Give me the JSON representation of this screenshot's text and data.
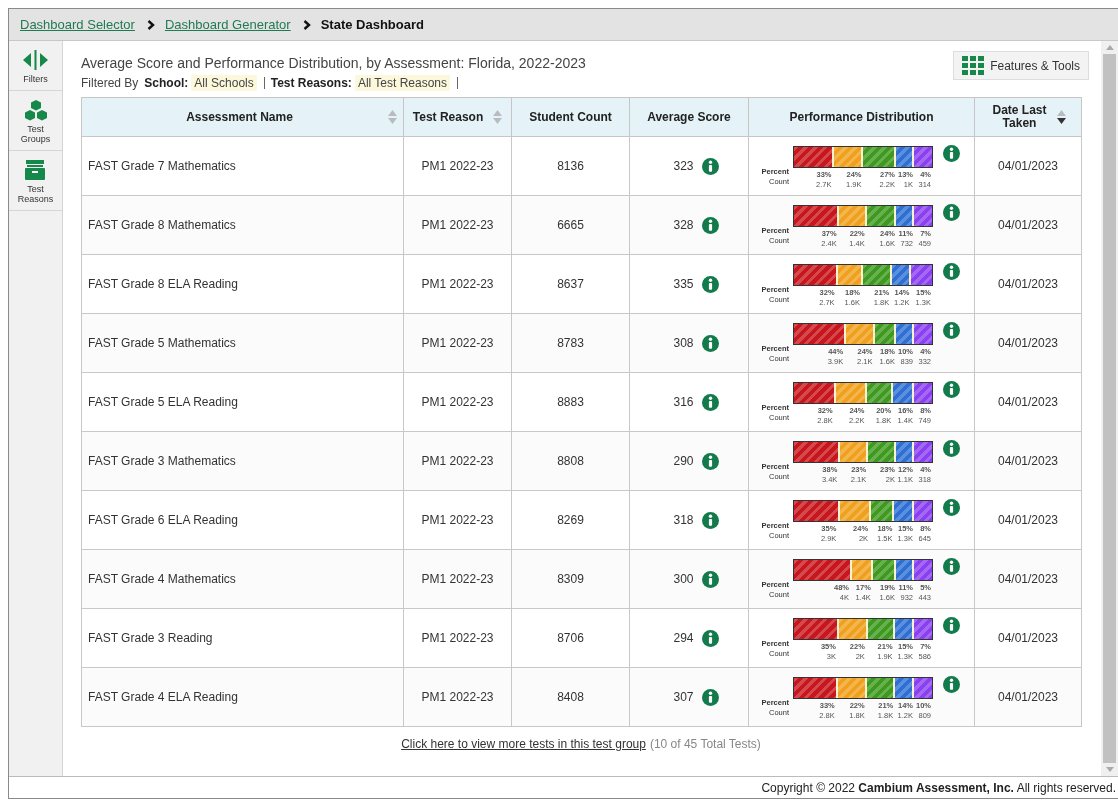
{
  "breadcrumbs": [
    {
      "label": "Dashboard Selector",
      "kind": "link"
    },
    {
      "label": "Dashboard Generator",
      "kind": "link"
    },
    {
      "label": "State Dashboard",
      "kind": "current"
    }
  ],
  "sidebar": {
    "items": [
      {
        "label": "Filters",
        "kind": "filters"
      },
      {
        "label": "Test Groups",
        "kind": "groups"
      },
      {
        "label": "Test Reasons",
        "kind": "reasons"
      }
    ]
  },
  "report": {
    "title": "Average Score and Performance Distribution, by Assessment: Florida, 2022-2023",
    "filtered_by": "Filtered By",
    "filters": [
      {
        "label": "School:",
        "value": "All Schools"
      },
      {
        "label": "Test Reasons:",
        "value": "All Test Reasons"
      }
    ],
    "tools_button": "Features & Tools"
  },
  "table": {
    "columns": [
      {
        "label": "Assessment Name",
        "sortable": true,
        "descending": false
      },
      {
        "label": "Test Reason",
        "sortable": true,
        "descending": false
      },
      {
        "label": "Student Count",
        "sortable": false
      },
      {
        "label": "Average Score",
        "sortable": false
      },
      {
        "label": "Performance Distribution",
        "sortable": false
      },
      {
        "label": "Date Last Taken",
        "sortable": true,
        "descending": true
      }
    ],
    "rows": [
      {
        "name": "FAST Grade 7 Mathematics",
        "reason": "PM1 2022-23",
        "count": "8136",
        "score": "323",
        "percent_label": "Percent",
        "count_label": "Count",
        "segments": [
          {
            "percent": "33%",
            "count": "2.7K",
            "color": "#c8161d"
          },
          {
            "percent": "24%",
            "count": "1.9K",
            "color": "#f0a01c"
          },
          {
            "percent": "27%",
            "count": "2.2K",
            "color": "#3e9a1e"
          },
          {
            "percent": "13%",
            "count": "1K",
            "color": "#2e6fd4"
          },
          {
            "percent": "4%",
            "count": "314",
            "color": "#8a3ff0"
          }
        ],
        "date": "04/01/2023"
      },
      {
        "name": "FAST Grade 8 Mathematics",
        "reason": "PM1 2022-23",
        "count": "6665",
        "score": "328",
        "percent_label": "Percent",
        "count_label": "Count",
        "segments": [
          {
            "percent": "37%",
            "count": "2.4K",
            "color": "#c8161d"
          },
          {
            "percent": "22%",
            "count": "1.4K",
            "color": "#f0a01c"
          },
          {
            "percent": "24%",
            "count": "1.6K",
            "color": "#3e9a1e"
          },
          {
            "percent": "11%",
            "count": "732",
            "color": "#2e6fd4"
          },
          {
            "percent": "7%",
            "count": "459",
            "color": "#8a3ff0"
          }
        ],
        "date": "04/01/2023"
      },
      {
        "name": "FAST Grade 8  ELA Reading",
        "reason": "PM1 2022-23",
        "count": "8637",
        "score": "335",
        "percent_label": "Percent",
        "count_label": "Count",
        "segments": [
          {
            "percent": "32%",
            "count": "2.7K",
            "color": "#c8161d"
          },
          {
            "percent": "18%",
            "count": "1.6K",
            "color": "#f0a01c"
          },
          {
            "percent": "21%",
            "count": "1.8K",
            "color": "#3e9a1e"
          },
          {
            "percent": "14%",
            "count": "1.2K",
            "color": "#2e6fd4"
          },
          {
            "percent": "15%",
            "count": "1.3K",
            "color": "#8a3ff0"
          }
        ],
        "date": "04/01/2023"
      },
      {
        "name": "FAST Grade 5 Mathematics",
        "reason": "PM1 2022-23",
        "count": "8783",
        "score": "308",
        "percent_label": "Percent",
        "count_label": "Count",
        "segments": [
          {
            "percent": "44%",
            "count": "3.9K",
            "color": "#c8161d"
          },
          {
            "percent": "24%",
            "count": "2.1K",
            "color": "#f0a01c"
          },
          {
            "percent": "18%",
            "count": "1.6K",
            "color": "#3e9a1e"
          },
          {
            "percent": "10%",
            "count": "839",
            "color": "#2e6fd4"
          },
          {
            "percent": "4%",
            "count": "332",
            "color": "#8a3ff0"
          }
        ],
        "date": "04/01/2023"
      },
      {
        "name": "FAST Grade 5  ELA Reading",
        "reason": "PM1 2022-23",
        "count": "8883",
        "score": "316",
        "percent_label": "Percent",
        "count_label": "Count",
        "segments": [
          {
            "percent": "32%",
            "count": "2.8K",
            "color": "#c8161d"
          },
          {
            "percent": "24%",
            "count": "2.2K",
            "color": "#f0a01c"
          },
          {
            "percent": "20%",
            "count": "1.8K",
            "color": "#3e9a1e"
          },
          {
            "percent": "16%",
            "count": "1.4K",
            "color": "#2e6fd4"
          },
          {
            "percent": "8%",
            "count": "749",
            "color": "#8a3ff0"
          }
        ],
        "date": "04/01/2023"
      },
      {
        "name": "FAST Grade 3 Mathematics",
        "reason": "PM1 2022-23",
        "count": "8808",
        "score": "290",
        "percent_label": "Percent",
        "count_label": "Count",
        "segments": [
          {
            "percent": "38%",
            "count": "3.4K",
            "color": "#c8161d"
          },
          {
            "percent": "23%",
            "count": "2.1K",
            "color": "#f0a01c"
          },
          {
            "percent": "23%",
            "count": "2K",
            "color": "#3e9a1e"
          },
          {
            "percent": "12%",
            "count": "1.1K",
            "color": "#2e6fd4"
          },
          {
            "percent": "4%",
            "count": "318",
            "color": "#8a3ff0"
          }
        ],
        "date": "04/01/2023"
      },
      {
        "name": "FAST Grade 6  ELA Reading",
        "reason": "PM1 2022-23",
        "count": "8269",
        "score": "318",
        "percent_label": "Percent",
        "count_label": "Count",
        "segments": [
          {
            "percent": "35%",
            "count": "2.9K",
            "color": "#c8161d"
          },
          {
            "percent": "24%",
            "count": "2K",
            "color": "#f0a01c"
          },
          {
            "percent": "18%",
            "count": "1.5K",
            "color": "#3e9a1e"
          },
          {
            "percent": "15%",
            "count": "1.3K",
            "color": "#2e6fd4"
          },
          {
            "percent": "8%",
            "count": "645",
            "color": "#8a3ff0"
          }
        ],
        "date": "04/01/2023"
      },
      {
        "name": "FAST Grade 4 Mathematics",
        "reason": "PM1 2022-23",
        "count": "8309",
        "score": "300",
        "percent_label": "Percent",
        "count_label": "Count",
        "segments": [
          {
            "percent": "48%",
            "count": "4K",
            "color": "#c8161d"
          },
          {
            "percent": "17%",
            "count": "1.4K",
            "color": "#f0a01c"
          },
          {
            "percent": "19%",
            "count": "1.6K",
            "color": "#3e9a1e"
          },
          {
            "percent": "11%",
            "count": "932",
            "color": "#2e6fd4"
          },
          {
            "percent": "5%",
            "count": "443",
            "color": "#8a3ff0"
          }
        ],
        "date": "04/01/2023"
      },
      {
        "name": "FAST Grade 3 Reading",
        "reason": "PM1 2022-23",
        "count": "8706",
        "score": "294",
        "percent_label": "Percent",
        "count_label": "Count",
        "segments": [
          {
            "percent": "35%",
            "count": "3K",
            "color": "#c8161d"
          },
          {
            "percent": "22%",
            "count": "2K",
            "color": "#f0a01c"
          },
          {
            "percent": "21%",
            "count": "1.9K",
            "color": "#3e9a1e"
          },
          {
            "percent": "15%",
            "count": "1.3K",
            "color": "#2e6fd4"
          },
          {
            "percent": "7%",
            "count": "586",
            "color": "#8a3ff0"
          }
        ],
        "date": "04/01/2023"
      },
      {
        "name": "FAST Grade 4  ELA Reading",
        "reason": "PM1 2022-23",
        "count": "8408",
        "score": "307",
        "percent_label": "Percent",
        "count_label": "Count",
        "segments": [
          {
            "percent": "33%",
            "count": "2.8K",
            "color": "#c8161d"
          },
          {
            "percent": "22%",
            "count": "1.8K",
            "color": "#f0a01c"
          },
          {
            "percent": "21%",
            "count": "1.8K",
            "color": "#3e9a1e"
          },
          {
            "percent": "14%",
            "count": "1.2K",
            "color": "#2e6fd4"
          },
          {
            "percent": "10%",
            "count": "809",
            "color": "#8a3ff0"
          }
        ],
        "date": "04/01/2023"
      }
    ]
  },
  "more_link": "Click here to view more tests in this test group",
  "more_count": "(10 of 45 Total Tests)",
  "copyright": "Copyright © 2022 **Cambium Assessment, Inc.** All rights reserved."
}
